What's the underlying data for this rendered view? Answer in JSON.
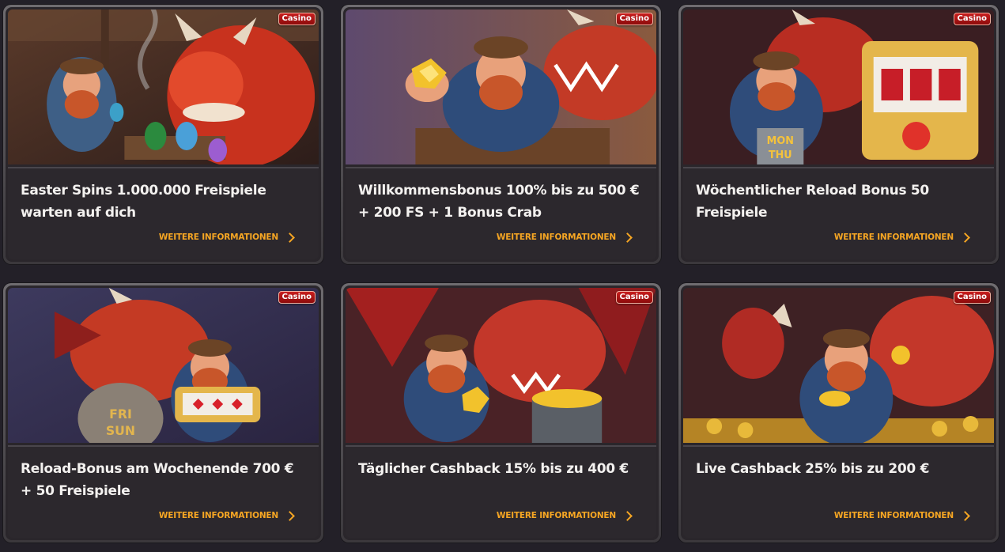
{
  "badge_label": "Casino",
  "more_label": "WEITERE INFORMATIONEN",
  "accent_color": "#f6a623",
  "badge_color": "#c81e1e",
  "cards": [
    {
      "title": "Easter Spins 1.000.000 Freispiele warten auf dich",
      "art": "dwarf-dragon-easter-eggs"
    },
    {
      "title": "Willkommensbonus 100% bis zu 500 € + 200 FS + 1 Bonus Crab",
      "art": "dwarf-gold-nugget-dragon"
    },
    {
      "title": "Wöchentlicher Reload Bonus 50 Freispiele",
      "art": "dwarf-dragon-slot-machine"
    },
    {
      "title": "Reload-Bonus am Wochenende 700 € + 50 Freispiele",
      "art": "dragon-dwarf-slot-reels"
    },
    {
      "title": "Täglicher Cashback 15% bis zu 400 €",
      "art": "dwarf-dragon-treasure-chest"
    },
    {
      "title": "Live Cashback 25% bis zu 200 €",
      "art": "dwarf-dragon-gold-coins"
    }
  ]
}
